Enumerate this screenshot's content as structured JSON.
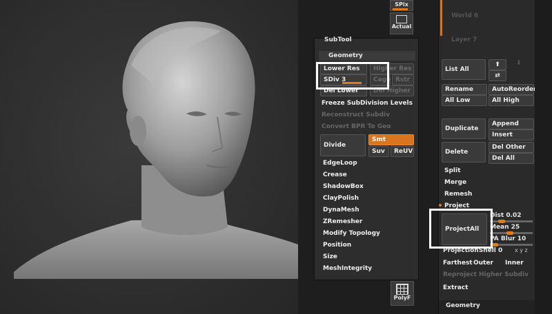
{
  "viewport": {
    "model": "sculpted-head"
  },
  "top_shelf": {
    "spix_label": "SPix",
    "actual_label": "Actual",
    "polyf_label": "PolyF"
  },
  "subtool_panel": {
    "title": "SubTool",
    "geometry_header": "Geometry",
    "lower_res": "Lower Res",
    "higher_res": "Higher Res",
    "sdiv": "SDiv 3",
    "cage": "Cage",
    "rstr": "Rstr",
    "del_lower": "Del Lower",
    "del_higher": "Del Higher",
    "freeze": "Freeze SubDivision Levels",
    "reconstruct": "Reconstruct Subdiv",
    "convert": "Convert BPR To Geo",
    "divide": "Divide",
    "smt": "Smt",
    "suv": "Suv",
    "reuv": "ReUV",
    "items": [
      "EdgeLoop",
      "Crease",
      "ShadowBox",
      "ClayPolish",
      "DynaMesh",
      "ZRemesher",
      "Modify Topology",
      "Position",
      "Size",
      "MeshIntegrity"
    ]
  },
  "right_panel": {
    "faded_top_1": "World 6",
    "faded_top_2": "Layer 7",
    "list_all": "List All",
    "rename": "Rename",
    "auto_reorder": "AutoReorder",
    "all_low": "All Low",
    "all_high": "All High",
    "duplicate": "Duplicate",
    "append": "Append",
    "insert": "Insert",
    "delete": "Delete",
    "del_other": "Del Other",
    "del_all": "Del All",
    "split": "Split",
    "merge": "Merge",
    "remesh": "Remesh",
    "project": "Project",
    "project_all": "ProjectAll",
    "dist": "Dist 0.02",
    "mean": "Mean 25",
    "pa_blur": "PA Blur 10",
    "projection_shell": "ProjectionShell 0",
    "xyz": "x y z",
    "farthest": "Farthest",
    "outer": "Outer",
    "inner": "Inner",
    "reproject": "Reproject Higher Subdiv",
    "extract": "Extract",
    "geometry_footer": "Geometry"
  }
}
